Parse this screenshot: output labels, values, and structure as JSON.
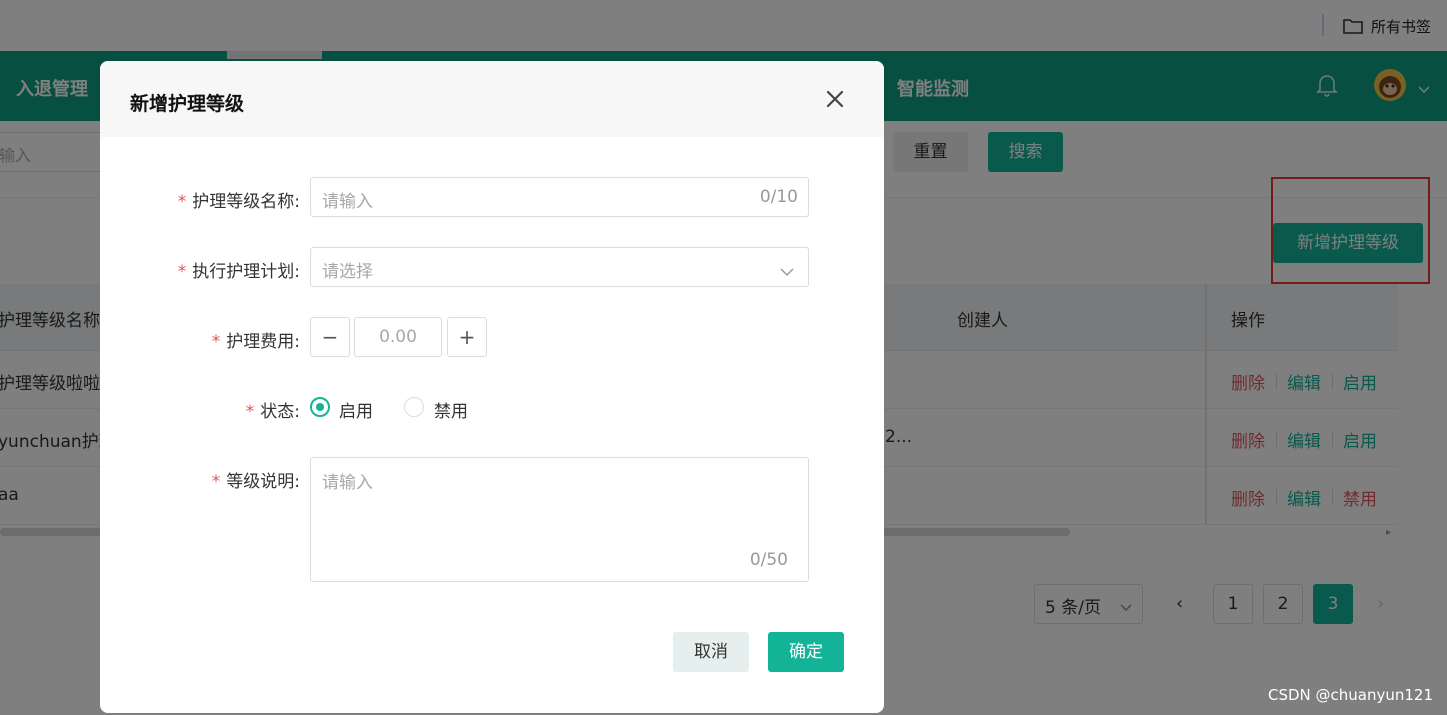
{
  "browser": {
    "bookmarks_folder": "所有书签"
  },
  "header": {
    "nav_left": "入退管理",
    "nav_right": "智能监测",
    "notification_icon": "bell-icon",
    "avatar_icon": "avatar-monkey-icon"
  },
  "filter": {
    "search_placeholder": "输入",
    "reset_label": "重置",
    "search_label": "搜索"
  },
  "toolbar": {
    "add_label": "新增护理等级"
  },
  "table": {
    "columns": [
      "护理等级名称",
      "创建人",
      "操作"
    ],
    "rows": [
      {
        "name": "护理等级啦啦",
        "creator": "",
        "ops": [
          "删除",
          "编辑",
          "启用"
        ]
      },
      {
        "name": "yunchuan护理",
        "creator": "2...",
        "ops": [
          "删除",
          "编辑",
          "启用"
        ]
      },
      {
        "name": "aa",
        "creator": "",
        "ops": [
          "删除",
          "编辑",
          "禁用"
        ]
      }
    ]
  },
  "pagination": {
    "page_size": "5 条/页",
    "prev": "‹",
    "next": "›",
    "pages": [
      "1",
      "2",
      "3"
    ],
    "current_page": "3"
  },
  "modal": {
    "title": "新增护理等级",
    "required_mark": "*",
    "fields": {
      "name_label": "护理等级名称:",
      "name_placeholder": "请输入",
      "name_counter": "0/10",
      "plan_label": "执行护理计划:",
      "plan_placeholder": "请选择",
      "fee_label": "护理费用:",
      "fee_value": "0.00",
      "fee_minus": "−",
      "fee_plus": "+",
      "status_label": "状态:",
      "status_options": [
        "启用",
        "禁用"
      ],
      "status_selected": "启用",
      "desc_label": "等级说明:",
      "desc_placeholder": "请输入",
      "desc_counter": "0/50"
    },
    "cancel_label": "取消",
    "confirm_label": "确定"
  },
  "watermark": "CSDN @chuanyun121",
  "colors": {
    "primary": "#13b398",
    "header_bg": "#0f9e83",
    "danger": "#e0565b",
    "highlight_box": "#e63a2f"
  }
}
